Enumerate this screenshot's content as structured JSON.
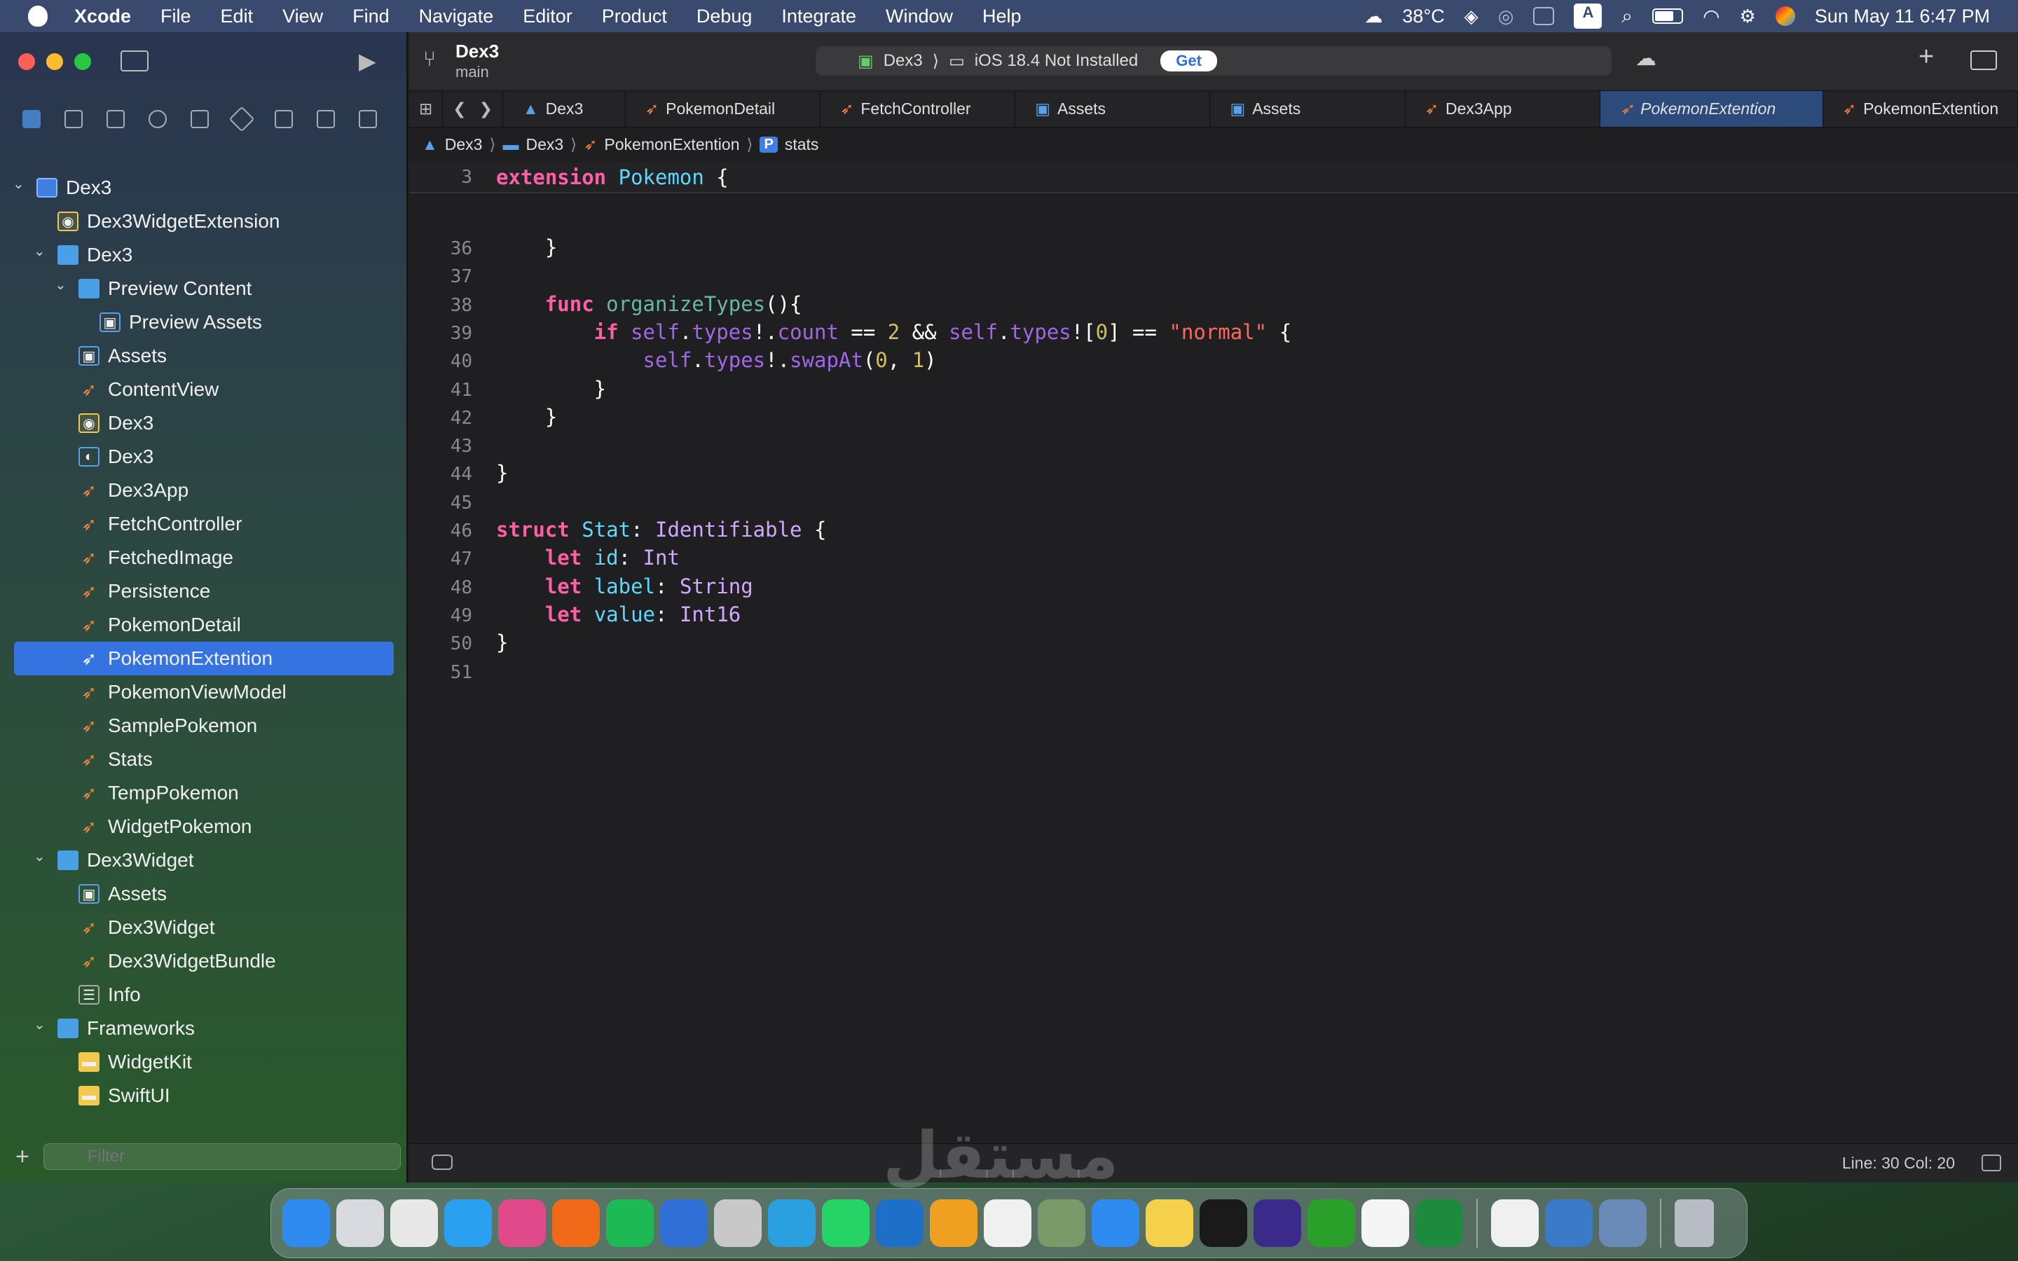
{
  "menubar": {
    "app_name": "Xcode",
    "items": [
      "File",
      "Edit",
      "View",
      "Find",
      "Navigate",
      "Editor",
      "Product",
      "Debug",
      "Integrate",
      "Window",
      "Help"
    ],
    "weather": "38°C",
    "input_badge": "A",
    "datetime": "Sun May 11  6:47 PM"
  },
  "toolbar": {
    "project_title": "Dex3",
    "branch": "main",
    "scheme": "Dex3",
    "destination": "iOS 18.4 Not Installed",
    "get_label": "Get"
  },
  "navigator": {
    "tree": [
      {
        "label": "Dex3",
        "icon": "project-icon",
        "depth": 0,
        "expanded": true
      },
      {
        "label": "Dex3WidgetExtension",
        "icon": "entitlements-icon",
        "depth": 1
      },
      {
        "label": "Dex3",
        "icon": "folder-icon",
        "depth": 1,
        "expanded": true
      },
      {
        "label": "Preview Content",
        "icon": "folder-icon",
        "depth": 2,
        "expanded": true
      },
      {
        "label": "Preview Assets",
        "icon": "assets-icon",
        "depth": 3
      },
      {
        "label": "Assets",
        "icon": "assets-icon",
        "depth": 2
      },
      {
        "label": "ContentView",
        "icon": "swift-icon",
        "depth": 2
      },
      {
        "label": "Dex3",
        "icon": "entitlements-icon",
        "depth": 2
      },
      {
        "label": "Dex3",
        "icon": "datamodel-icon",
        "depth": 2
      },
      {
        "label": "Dex3App",
        "icon": "swift-icon",
        "depth": 2
      },
      {
        "label": "FetchController",
        "icon": "swift-icon",
        "depth": 2
      },
      {
        "label": "FetchedImage",
        "icon": "swift-icon",
        "depth": 2
      },
      {
        "label": "Persistence",
        "icon": "swift-icon",
        "depth": 2
      },
      {
        "label": "PokemonDetail",
        "icon": "swift-icon",
        "depth": 2
      },
      {
        "label": "PokemonExtention",
        "icon": "swift-icon",
        "depth": 2,
        "selected": true
      },
      {
        "label": "PokemonViewModel",
        "icon": "swift-icon",
        "depth": 2
      },
      {
        "label": "SamplePokemon",
        "icon": "swift-icon",
        "depth": 2
      },
      {
        "label": "Stats",
        "icon": "swift-icon",
        "depth": 2
      },
      {
        "label": "TempPokemon",
        "icon": "swift-icon",
        "depth": 2
      },
      {
        "label": "WidgetPokemon",
        "icon": "swift-icon",
        "depth": 2
      },
      {
        "label": "Dex3Widget",
        "icon": "folder-icon",
        "depth": 1,
        "expanded": true
      },
      {
        "label": "Assets",
        "icon": "assets-icon",
        "depth": 2
      },
      {
        "label": "Dex3Widget",
        "icon": "swift-icon",
        "depth": 2
      },
      {
        "label": "Dex3WidgetBundle",
        "icon": "swift-icon",
        "depth": 2
      },
      {
        "label": "Info",
        "icon": "info-icon",
        "depth": 2
      },
      {
        "label": "Frameworks",
        "icon": "folder-icon",
        "depth": 1,
        "expanded": true
      },
      {
        "label": "WidgetKit",
        "icon": "framework-icon",
        "depth": 2
      },
      {
        "label": "SwiftUI",
        "icon": "framework-icon",
        "depth": 2
      }
    ],
    "filter_placeholder": "Filter"
  },
  "tabs": [
    {
      "label": "Dex3",
      "icon": "project-icon"
    },
    {
      "label": "PokemonDetail",
      "icon": "swift-icon"
    },
    {
      "label": "FetchController",
      "icon": "swift-icon"
    },
    {
      "label": "Assets",
      "icon": "assets-icon"
    },
    {
      "label": "Assets",
      "icon": "assets-icon"
    },
    {
      "label": "Dex3App",
      "icon": "swift-icon"
    },
    {
      "label": "PokemonExtention",
      "icon": "swift-icon",
      "active": true
    },
    {
      "label": "PokemonExtention",
      "icon": "swift-icon"
    }
  ],
  "breadcrumb": [
    "Dex3",
    "Dex3",
    "PokemonExtention",
    "stats"
  ],
  "editor": {
    "sticky": {
      "line": "3",
      "text": "extension Pokemon {"
    },
    "lines": [
      {
        "n": "36"
      },
      {
        "n": "37"
      },
      {
        "n": "38"
      },
      {
        "n": "39"
      },
      {
        "n": "40"
      },
      {
        "n": "41"
      },
      {
        "n": "42"
      },
      {
        "n": "43"
      },
      {
        "n": "44"
      },
      {
        "n": "45"
      },
      {
        "n": "46"
      },
      {
        "n": "47"
      },
      {
        "n": "48"
      },
      {
        "n": "49"
      },
      {
        "n": "50"
      },
      {
        "n": "51"
      }
    ]
  },
  "statusbar": {
    "position": "Line: 30  Col: 20"
  },
  "watermark": "مستقل",
  "colors": {
    "accent": "#3573e0",
    "keyword": "#fc5fa3",
    "type": "#5dd8ff",
    "string": "#fc6a5d",
    "number": "#d0bf69"
  }
}
